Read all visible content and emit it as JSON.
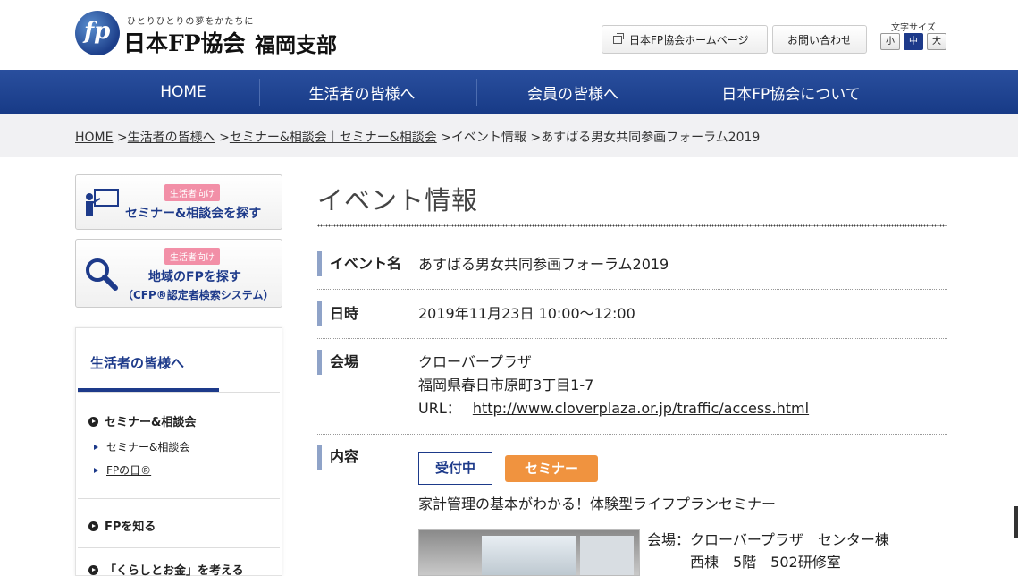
{
  "header": {
    "logo_mark": "fp",
    "tagline": "ひとりひとりの夢をかたちに",
    "org_name": "日本FP協会",
    "branch": "福岡支部",
    "home_link": "日本FP協会ホームページ",
    "contact": "お問い合わせ",
    "font_size_label": "文字サイズ",
    "font_sizes": [
      "小",
      "中",
      "大"
    ]
  },
  "nav": {
    "items": [
      "HOME",
      "生活者の皆様へ",
      "会員の皆様へ",
      "日本FP協会について"
    ]
  },
  "breadcrumb": {
    "home": "HOME",
    "sep": " >",
    "consumers": "生活者の皆様へ",
    "seminar": "セミナー&相談会｜セミナー&相談会",
    "event_info": "イベント情報",
    "current": "あすばる男女共同参画フォーラム2019"
  },
  "sidebar": {
    "banner1": {
      "tag": "生活者向け",
      "title": "セミナー&相談会を探す"
    },
    "banner2": {
      "tag": "生活者向け",
      "title": "地域のFPを探す",
      "sub": "（CFP®認定者検索システム）"
    },
    "menu_head": "生活者の皆様へ",
    "item_seminar": "セミナー&相談会",
    "sub_seminar": "セミナー&相談会",
    "sub_fpday": "FPの日®",
    "item_know_fp": "FPを知る",
    "item_cutoff": "「くらしとお金」を考える"
  },
  "main": {
    "title": "イベント情報",
    "event_label": "イベント名",
    "event_value": "あすばる男女共同参画フォーラム2019",
    "date_label": "日時",
    "date_value": "2019年11月23日 10:00〜12:00",
    "venue_label": "会場",
    "venue_name": "クローバープラザ",
    "venue_address": "福岡県春日市原町3丁目1-7",
    "venue_url_prefix": "URL：",
    "venue_url": "http://www.cloverplaza.or.jp/traffic/access.html",
    "content_label": "内容",
    "badge_open": "受付中",
    "badge_type": "セミナー",
    "content_title": "家計管理の基本がわかる！体験型ライフプランセミナー",
    "detail_line1": "会場：クローバープラザ　センター棟",
    "detail_line2": "　　　西棟　5階　502研修室"
  },
  "colors": {
    "navy": "#1d3a8a",
    "orange": "#f0933f",
    "pink": "#f28fa7"
  }
}
